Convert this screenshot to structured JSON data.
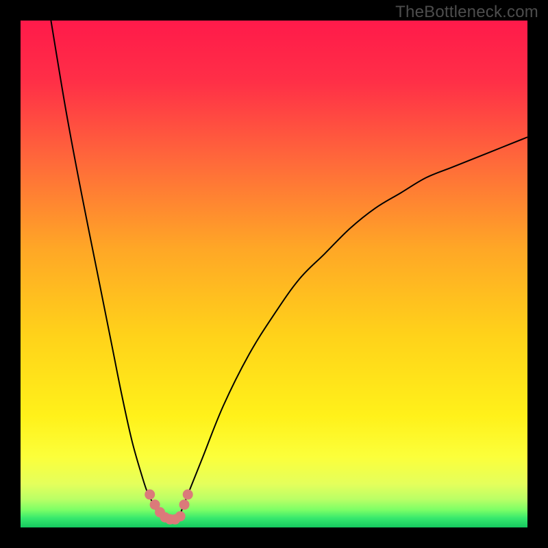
{
  "watermark": "TheBottleneck.com",
  "chart_data": {
    "type": "line",
    "title": "",
    "xlabel": "",
    "ylabel": "",
    "xlim": [
      0,
      100
    ],
    "ylim": [
      0,
      100
    ],
    "series": [
      {
        "name": "curve-left",
        "x": [
          6,
          9,
          12,
          15,
          18,
          20,
          22,
          24,
          25,
          26,
          27,
          28
        ],
        "y": [
          100,
          82,
          66,
          51,
          36,
          26,
          17,
          10,
          7,
          5,
          3,
          2
        ]
      },
      {
        "name": "curve-right",
        "x": [
          32,
          34,
          36,
          40,
          45,
          50,
          55,
          60,
          65,
          70,
          75,
          80,
          85,
          90,
          95,
          100
        ],
        "y": [
          4,
          9,
          14,
          24,
          34,
          42,
          49,
          54,
          59,
          63,
          66,
          69,
          71,
          73,
          75,
          77
        ]
      },
      {
        "name": "valley-flat",
        "x": [
          28,
          29,
          30,
          31,
          32
        ],
        "y": [
          2,
          1.5,
          1.4,
          1.5,
          4
        ]
      }
    ],
    "scatter": {
      "name": "valley-dots",
      "x": [
        25.5,
        26.5,
        27.5,
        28.5,
        29.5,
        30.5,
        31.5,
        32.3,
        33.0
      ],
      "y": [
        6.5,
        4.5,
        3.0,
        2.0,
        1.6,
        1.6,
        2.2,
        4.5,
        6.5
      ]
    },
    "gradient_stops": [
      {
        "offset": 0.0,
        "color": "#ff1a4a"
      },
      {
        "offset": 0.12,
        "color": "#ff2f47"
      },
      {
        "offset": 0.28,
        "color": "#ff6a3a"
      },
      {
        "offset": 0.45,
        "color": "#ffa726"
      },
      {
        "offset": 0.62,
        "color": "#ffd21a"
      },
      {
        "offset": 0.78,
        "color": "#fff11a"
      },
      {
        "offset": 0.86,
        "color": "#fcff3a"
      },
      {
        "offset": 0.915,
        "color": "#e4ff5c"
      },
      {
        "offset": 0.945,
        "color": "#b8ff66"
      },
      {
        "offset": 0.965,
        "color": "#7dff66"
      },
      {
        "offset": 0.982,
        "color": "#36e86d"
      },
      {
        "offset": 1.0,
        "color": "#15c85f"
      }
    ]
  }
}
